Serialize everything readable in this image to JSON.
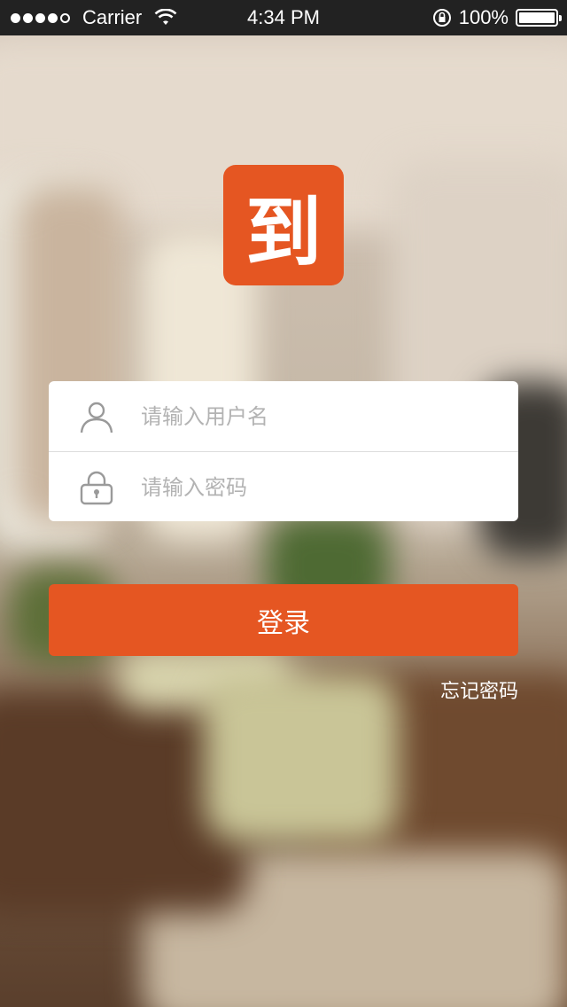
{
  "status_bar": {
    "carrier": "Carrier",
    "time": "4:34 PM",
    "battery": "100%",
    "signal_icon": "signal-dots-icon",
    "wifi_icon": "wifi-icon",
    "rotation_lock_icon": "rotation-lock-icon",
    "battery_icon": "battery-icon"
  },
  "logo": {
    "text": "到",
    "color": "#e55622"
  },
  "login_form": {
    "username_placeholder": "请输入用户名",
    "password_placeholder": "请输入密码",
    "username_icon": "user-icon",
    "password_icon": "lock-icon"
  },
  "login_button": {
    "label": "登录",
    "color": "#e55622"
  },
  "forgot_password": {
    "label": "忘记密码"
  }
}
